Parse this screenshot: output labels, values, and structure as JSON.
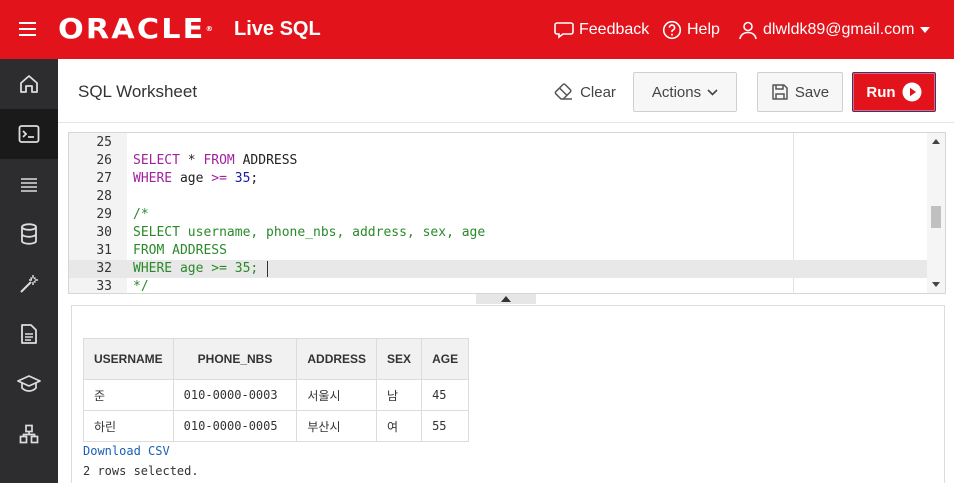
{
  "header": {
    "brand": "ORACLE",
    "product": "Live SQL",
    "feedback": "Feedback",
    "help": "Help",
    "user": "dlwldk89@gmail.com"
  },
  "nav": {
    "items": [
      "home-icon",
      "worksheet-icon",
      "list-icon",
      "database-icon",
      "wand-icon",
      "document-icon",
      "graduation-cap-icon",
      "schema-icon"
    ],
    "active": "worksheet-icon"
  },
  "worksheet": {
    "title": "SQL Worksheet",
    "clear_label": "Clear",
    "actions_label": "Actions",
    "save_label": "Save",
    "run_label": "Run"
  },
  "editor": {
    "current_line": 32,
    "lines": [
      {
        "n": "25",
        "code": ""
      },
      {
        "n": "26",
        "code": "SELECT * FROM ADDRESS"
      },
      {
        "n": "27",
        "code": "WHERE age >= 35;"
      },
      {
        "n": "28",
        "code": ""
      },
      {
        "n": "29",
        "code": "/*"
      },
      {
        "n": "30",
        "code": "SELECT username, phone_nbs, address, sex, age"
      },
      {
        "n": "31",
        "code": "FROM ADDRESS"
      },
      {
        "n": "32",
        "code": "WHERE age >= 35;"
      },
      {
        "n": "33",
        "code": "*/"
      }
    ]
  },
  "results": {
    "columns": [
      "USERNAME",
      "PHONE_NBS",
      "ADDRESS",
      "SEX",
      "AGE"
    ],
    "rows": [
      [
        "준",
        "010-0000-0003",
        "서울시",
        "남",
        "45"
      ],
      [
        "하린",
        "010-0000-0005",
        "부산시",
        "여",
        "55"
      ]
    ],
    "download_label": "Download CSV",
    "rows_selected": "2 rows selected."
  },
  "colors": {
    "brand_red": "#e3131b",
    "nav_bg": "#2d2d2f",
    "keyword": "#a0229d",
    "number": "#1a1aa6",
    "comment": "#2a8a2a",
    "link": "#1a5fb4"
  }
}
